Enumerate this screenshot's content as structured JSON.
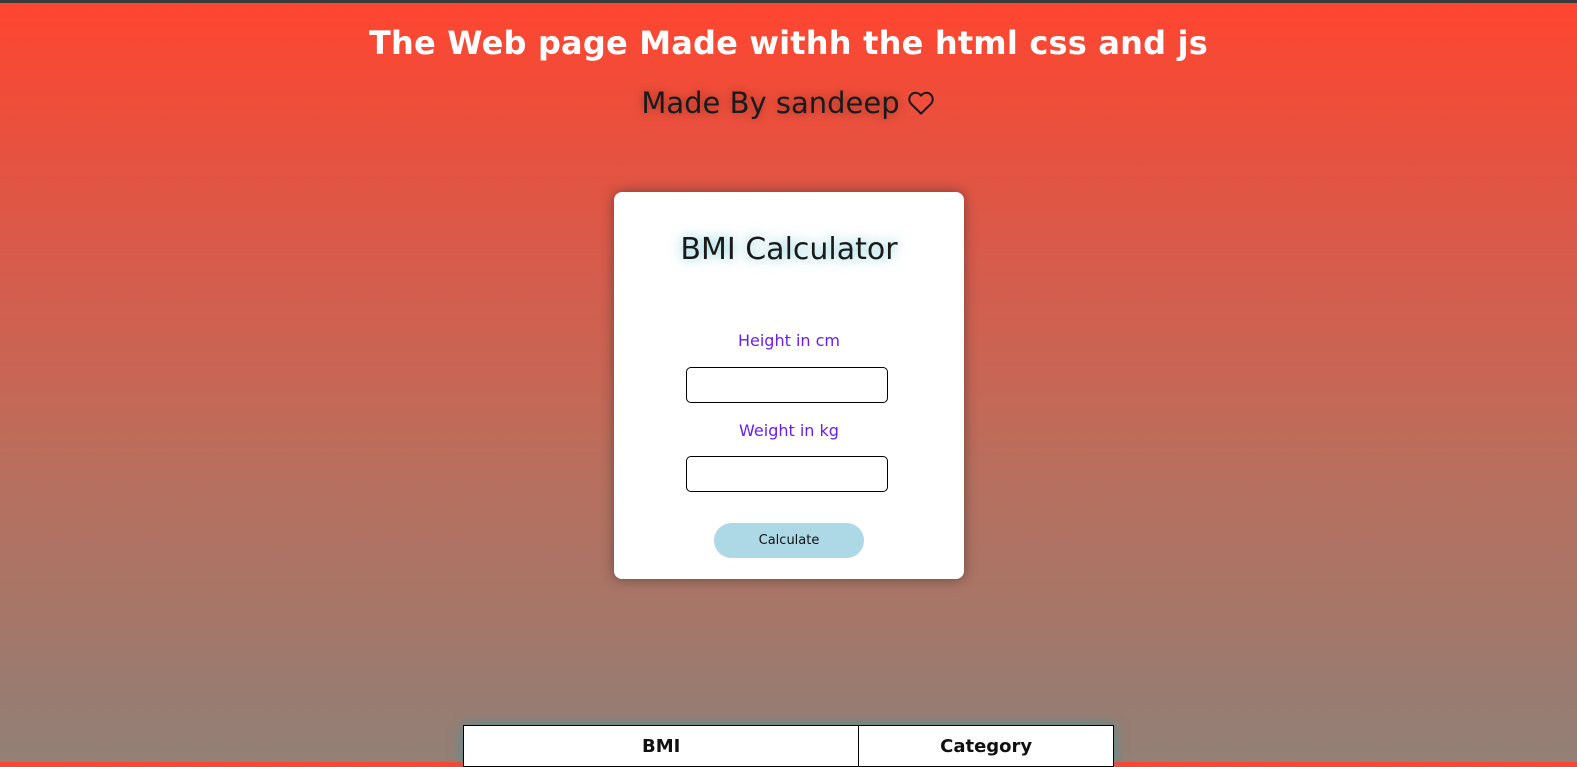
{
  "header": {
    "title": "The Web page Made withh the html css and js",
    "byline": "Made By sandeep",
    "byline_icon": "heart-icon"
  },
  "calculator": {
    "title": "BMI Calculator",
    "height_label": "Height in cm",
    "height_value": "",
    "weight_label": "Weight in kg",
    "weight_value": "",
    "button_label": "Calculate"
  },
  "table": {
    "headers": [
      "BMI",
      "Category"
    ]
  },
  "colors": {
    "gradient_top": "#ff4530",
    "gradient_bottom": "#938076",
    "label_color": "#6a1df2",
    "button_color": "#add8e6",
    "card_background": "#ffffff"
  }
}
